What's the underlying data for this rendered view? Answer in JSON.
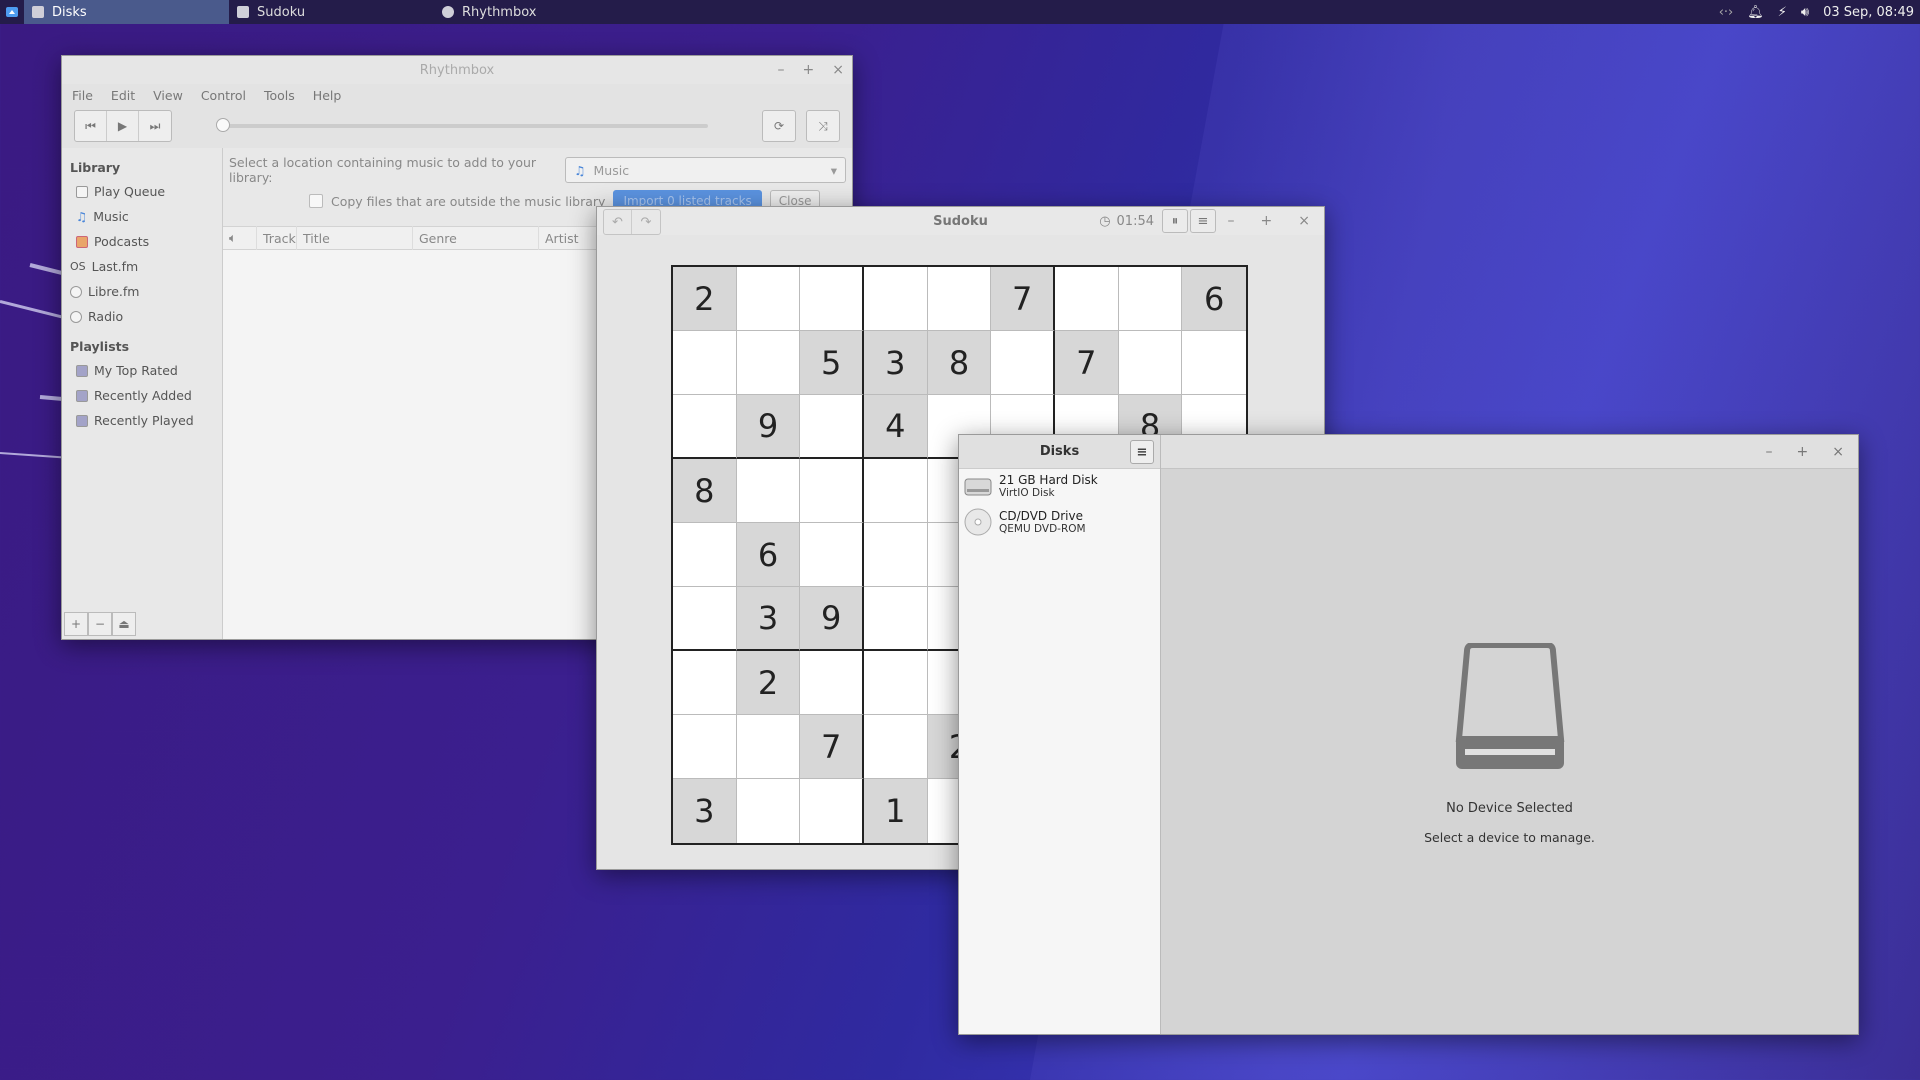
{
  "panel": {
    "tasks": [
      {
        "label": "Disks",
        "active": true
      },
      {
        "label": "Sudoku",
        "active": false
      },
      {
        "label": "Rhythmbox",
        "active": false
      }
    ],
    "clock": "03 Sep, 08:49"
  },
  "rhythmbox": {
    "title": "Rhythmbox",
    "menu": [
      "File",
      "Edit",
      "View",
      "Control",
      "Tools",
      "Help"
    ],
    "library_header": "Library",
    "library_items": [
      "Play Queue",
      "Music",
      "Podcasts",
      "Last.fm",
      "Libre.fm",
      "Radio"
    ],
    "playlists_header": "Playlists",
    "playlist_items": [
      "My Top Rated",
      "Recently Added",
      "Recently Played"
    ],
    "import_label": "Select a location containing music to add to your library:",
    "import_location": "Music",
    "copy_files_label": "Copy files that are outside the music library",
    "import_button": "Import 0 listed tracks",
    "close_button": "Close",
    "columns": [
      "Track",
      "Title",
      "Genre",
      "Artist"
    ]
  },
  "sudoku": {
    "title": "Sudoku",
    "timer": "01:54",
    "grid": [
      [
        "2",
        "",
        "",
        "",
        "",
        "7",
        "",
        "",
        "6"
      ],
      [
        "",
        "",
        "5",
        "3",
        "8",
        "",
        "7",
        "",
        ""
      ],
      [
        "",
        "9",
        "",
        "4",
        "",
        "",
        "",
        "8",
        ""
      ],
      [
        "8",
        "",
        "",
        "",
        "",
        "",
        "",
        "",
        ""
      ],
      [
        "",
        "6",
        "",
        "",
        "",
        "",
        "",
        "",
        ""
      ],
      [
        "",
        "3",
        "9",
        "",
        "",
        "",
        "",
        "",
        ""
      ],
      [
        "",
        "2",
        "",
        "",
        "",
        "",
        "",
        "",
        ""
      ],
      [
        "",
        "",
        "7",
        "",
        "2",
        "",
        "",
        "",
        ""
      ],
      [
        "3",
        "",
        "",
        "1",
        "",
        "",
        "",
        "",
        ""
      ]
    ]
  },
  "disks": {
    "title": "Disks",
    "devices": [
      {
        "name": "21 GB Hard Disk",
        "model": "VirtIO Disk",
        "icon": "hard-disk-icon"
      },
      {
        "name": "CD/DVD Drive",
        "model": "QEMU DVD-ROM",
        "icon": "optical-drive-icon"
      }
    ],
    "empty_title": "No Device Selected",
    "empty_subtitle": "Select a device to manage."
  }
}
